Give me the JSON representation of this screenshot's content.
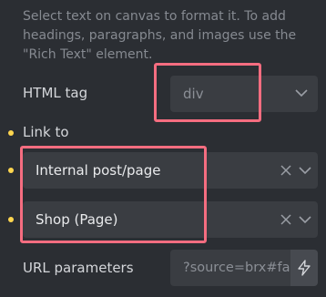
{
  "help_text": {
    "line1": "Select text on canvas to format it. To add",
    "line2": "headings, paragraphs, and images use the",
    "line3": "\"Rich Text\" element."
  },
  "html_tag": {
    "label": "HTML tag",
    "value": "div"
  },
  "link_to": {
    "label": "Link to",
    "type_value": "Internal post/page",
    "target_value": "Shop (Page)"
  },
  "url_parameters": {
    "label": "URL parameters",
    "value": "?source=brx#fa"
  },
  "icons": {
    "dropdown": "chevron-down-icon",
    "clear": "close-icon",
    "dynamic_data": "bolt-icon"
  },
  "colors": {
    "background": "#2b2e33",
    "field": "#3a3d42",
    "highlight": "#f56d80",
    "indicator_dot": "#ffd64f"
  }
}
